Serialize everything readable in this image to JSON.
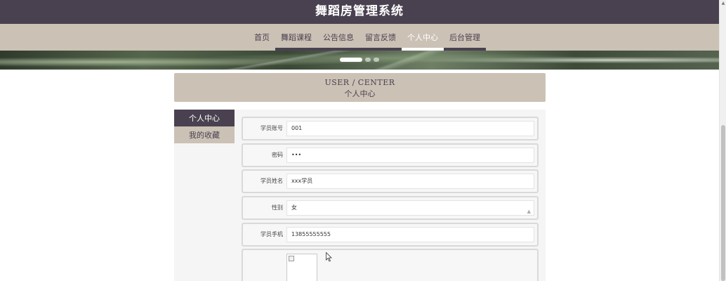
{
  "site": {
    "title": "舞蹈房管理系统"
  },
  "nav": {
    "items": [
      {
        "label": "首页"
      },
      {
        "label": "舞蹈课程"
      },
      {
        "label": "公告信息"
      },
      {
        "label": "留言反馈"
      },
      {
        "label": "个人中心",
        "active": true
      },
      {
        "label": "后台管理"
      }
    ]
  },
  "banner": {
    "slide_count": 3,
    "active_slide": 1
  },
  "section": {
    "title_en": "USER / CENTER",
    "title_cn": "个人中心"
  },
  "sidebar": {
    "items": [
      {
        "label": "个人中心",
        "active": true
      },
      {
        "label": "我的收藏",
        "active": false
      }
    ]
  },
  "form": {
    "fields": [
      {
        "label": "学员账号",
        "value": "001"
      },
      {
        "label": "密码",
        "value": "•••"
      },
      {
        "label": "学员姓名",
        "value": "xxx学员"
      },
      {
        "label": "性别",
        "value": "女"
      },
      {
        "label": "学员手机",
        "value": "13855555555"
      }
    ]
  },
  "colors": {
    "dark": "#4a4150",
    "beige": "#cbc1b5",
    "panel": "#f5f5f5"
  }
}
